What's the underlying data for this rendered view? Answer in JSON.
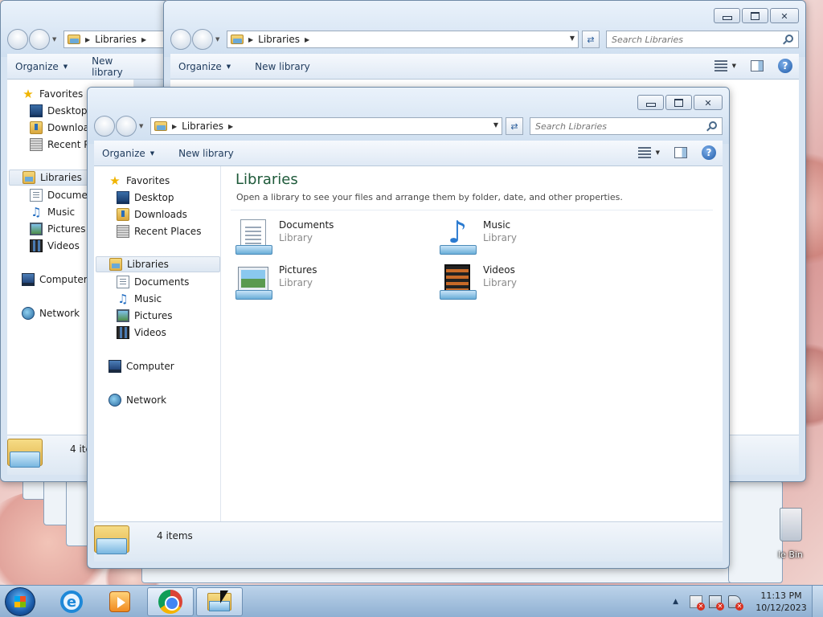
{
  "desktop": {
    "recycle_bin_label": "le Bin"
  },
  "back_window": {
    "breadcrumb": "Libraries",
    "search_placeholder": "Search Libraries",
    "toolbar": {
      "organize": "Organize",
      "new_library": "New library"
    },
    "nav": [
      {
        "label": "Favorites",
        "icon": "star-icon"
      },
      {
        "label": "Desktop",
        "icon": "desktop-icon"
      },
      {
        "label": "Downloads",
        "icon": "downloads-icon"
      },
      {
        "label": "Recent Places",
        "icon": "recent-places-icon"
      },
      {
        "label": "Libraries",
        "icon": "libraries-icon"
      },
      {
        "label": "Documents",
        "icon": "documents-icon"
      },
      {
        "label": "Music",
        "icon": "music-icon"
      },
      {
        "label": "Pictures",
        "icon": "pictures-icon"
      },
      {
        "label": "Videos",
        "icon": "videos-icon"
      },
      {
        "label": "Computer",
        "icon": "computer-icon"
      },
      {
        "label": "Network",
        "icon": "network-icon"
      }
    ],
    "status": "4 items"
  },
  "front_window": {
    "breadcrumb": "Libraries",
    "search_placeholder": "Search Libraries",
    "toolbar": {
      "organize": "Organize",
      "new_library": "New library"
    },
    "nav": [
      {
        "label": "Favorites",
        "icon": "star-icon"
      },
      {
        "label": "Desktop",
        "icon": "desktop-icon"
      },
      {
        "label": "Downloads",
        "icon": "downloads-icon"
      },
      {
        "label": "Recent Places",
        "icon": "recent-places-icon"
      },
      {
        "label": "Libraries",
        "icon": "libraries-icon"
      },
      {
        "label": "Documents",
        "icon": "documents-icon"
      },
      {
        "label": "Music",
        "icon": "music-icon"
      },
      {
        "label": "Pictures",
        "icon": "pictures-icon"
      },
      {
        "label": "Videos",
        "icon": "videos-icon"
      },
      {
        "label": "Computer",
        "icon": "computer-icon"
      },
      {
        "label": "Network",
        "icon": "network-icon"
      }
    ],
    "content": {
      "title": "Libraries",
      "description": "Open a library to see your files and arrange them by folder, date, and other properties.",
      "libraries": [
        {
          "name": "Documents",
          "type": "Library",
          "icon": "documents-library-icon"
        },
        {
          "name": "Music",
          "type": "Library",
          "icon": "music-library-icon"
        },
        {
          "name": "Pictures",
          "type": "Library",
          "icon": "pictures-library-icon"
        },
        {
          "name": "Videos",
          "type": "Library",
          "icon": "videos-library-icon"
        }
      ]
    },
    "status": "4 items"
  },
  "taskbar": {
    "apps": [
      "internet-explorer-icon",
      "media-player-icon",
      "chrome-icon",
      "windows-explorer-icon"
    ],
    "clock_time": "11:13 PM",
    "clock_date": "10/12/2023"
  },
  "colors": {
    "title_green": "#1e5a3a",
    "accent_blue": "#1e5aa8",
    "taskbar": "#8fb0d2"
  }
}
